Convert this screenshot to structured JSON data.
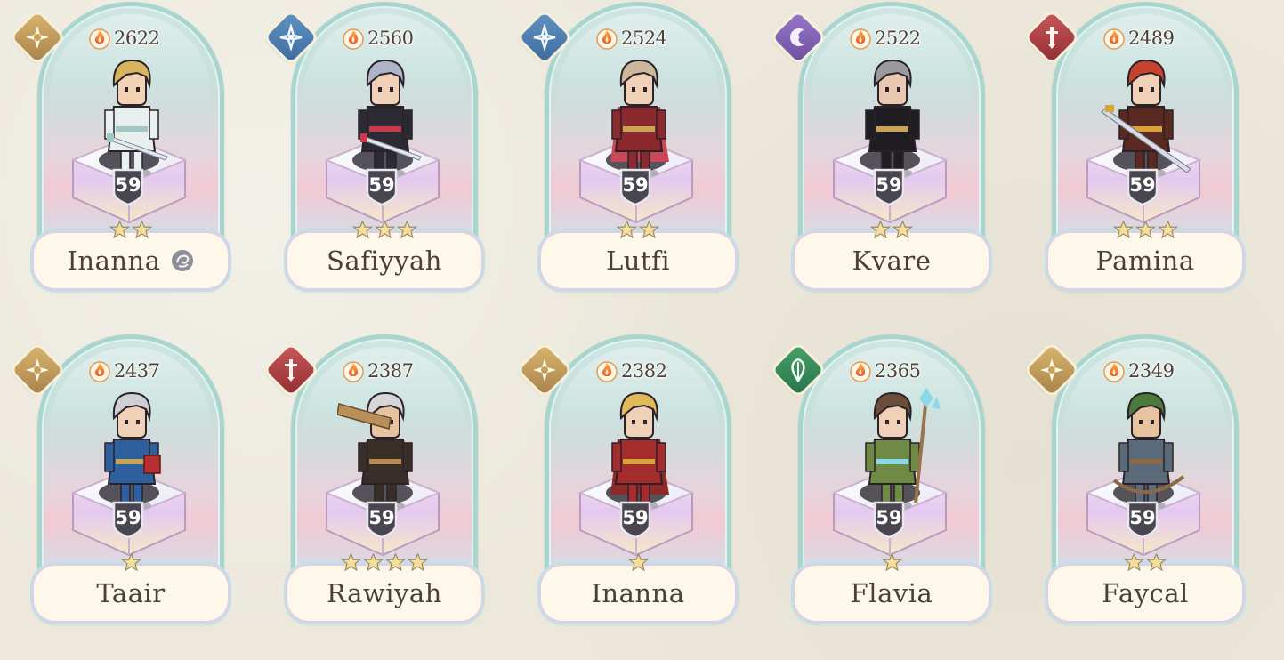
{
  "units": [
    {
      "name": "Inanna",
      "power": "2622",
      "level": "59",
      "stars": 2,
      "element": "light",
      "has_badge": true
    },
    {
      "name": "Safiyyah",
      "power": "2560",
      "level": "59",
      "stars": 3,
      "element": "wind"
    },
    {
      "name": "Lutfi",
      "power": "2524",
      "level": "59",
      "stars": 2,
      "element": "wind"
    },
    {
      "name": "Kvare",
      "power": "2522",
      "level": "59",
      "stars": 2,
      "element": "dark"
    },
    {
      "name": "Pamina",
      "power": "2489",
      "level": "59",
      "stars": 3,
      "element": "fire"
    },
    {
      "name": "Taair",
      "power": "2437",
      "level": "59",
      "stars": 1,
      "element": "light"
    },
    {
      "name": "Rawiyah",
      "power": "2387",
      "level": "59",
      "stars": 4,
      "element": "fire"
    },
    {
      "name": "Inanna",
      "power": "2382",
      "level": "59",
      "stars": 1,
      "element": "light"
    },
    {
      "name": "Flavia",
      "power": "2365",
      "level": "59",
      "stars": 1,
      "element": "earth"
    },
    {
      "name": "Faycal",
      "power": "2349",
      "level": "59",
      "stars": 2,
      "element": "light"
    }
  ],
  "colors": {
    "light": "#c09a5a",
    "wind": "#4f80b3",
    "dark": "#8462b6",
    "fire": "#ad3f45",
    "earth": "#37895a",
    "star": "#f4df9a",
    "level_shield": "#4a4650"
  },
  "icons": {
    "power": "flame-icon",
    "star": "star-icon",
    "level": "level-shield-icon",
    "light": "light-element-icon",
    "wind": "wind-element-icon",
    "dark": "dark-element-icon",
    "fire": "fire-element-icon",
    "earth": "earth-element-icon",
    "badge": "swirl-badge-icon"
  },
  "sprites": [
    {
      "hair": "#d9b45e",
      "outfit": "#e7f0ee",
      "accent": "#9fc7c4",
      "skin": "#f3d2b3",
      "weapon": "sword"
    },
    {
      "hair": "#aeb4c8",
      "outfit": "#2c2a33",
      "accent": "#c93a4a",
      "skin": "#f1d0b8",
      "weapon": "sword"
    },
    {
      "hair": "#cdb69a",
      "outfit": "#8a2a2e",
      "accent": "#c9a454",
      "skin": "#f1d0b8",
      "weapon": "cape"
    },
    {
      "hair": "#9a9aa0",
      "outfit": "#1f1c22",
      "accent": "#c9a454",
      "skin": "#e8c8b0",
      "weapon": "none"
    },
    {
      "hair": "#c8432d",
      "outfit": "#5a2a22",
      "accent": "#d8a43a",
      "skin": "#f1d0b8",
      "weapon": "lance"
    },
    {
      "hair": "#cfcfd6",
      "outfit": "#2e5f9e",
      "accent": "#c9a454",
      "skin": "#f1d0b8",
      "weapon": "book"
    },
    {
      "hair": "#d6d6d6",
      "outfit": "#3a2e28",
      "accent": "#b78a52",
      "skin": "#e7c3a0",
      "weapon": "greatsword"
    },
    {
      "hair": "#e2b95a",
      "outfit": "#a42c2c",
      "accent": "#d8a43a",
      "skin": "#f1d0b8",
      "weapon": "cape"
    },
    {
      "hair": "#6a4e3a",
      "outfit": "#6f8a44",
      "accent": "#8bd8e8",
      "skin": "#f1d0b8",
      "weapon": "staff"
    },
    {
      "hair": "#4b7a3a",
      "outfit": "#5a6a7a",
      "accent": "#8a6a44",
      "skin": "#e7c3a0",
      "weapon": "bow"
    }
  ]
}
